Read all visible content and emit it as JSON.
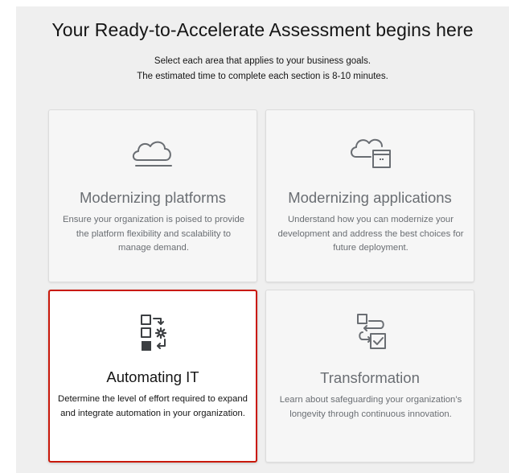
{
  "header": {
    "title": "Your Ready-to-Accelerate Assessment begins here",
    "subtitle_line1": "Select each area that applies to your business goals.",
    "subtitle_line2": "The estimated time to complete each section is 8-10 minutes."
  },
  "cards": [
    {
      "title": "Modernizing platforms",
      "description": "Ensure your organization is poised to provide the platform flexibility and scalability to manage demand.",
      "icon": "cloud-icon",
      "selected": false
    },
    {
      "title": "Modernizing applications",
      "description": "Understand how you can modernize your development and address the best choices for future deployment.",
      "icon": "cloud-app-icon",
      "selected": false
    },
    {
      "title": "Automating IT",
      "description": "Determine the level of effort required to expand and integrate automation in your organization.",
      "icon": "automation-icon",
      "selected": true
    },
    {
      "title": "Transformation",
      "description": "Learn about safeguarding your organization’s longevity through continuous innovation.",
      "icon": "transformation-icon",
      "selected": false
    }
  ],
  "colors": {
    "panel_background": "#efefef",
    "card_background": "#f6f6f6",
    "selected_border": "#c9190b",
    "muted_text": "#6a6e73",
    "text": "#151515"
  }
}
